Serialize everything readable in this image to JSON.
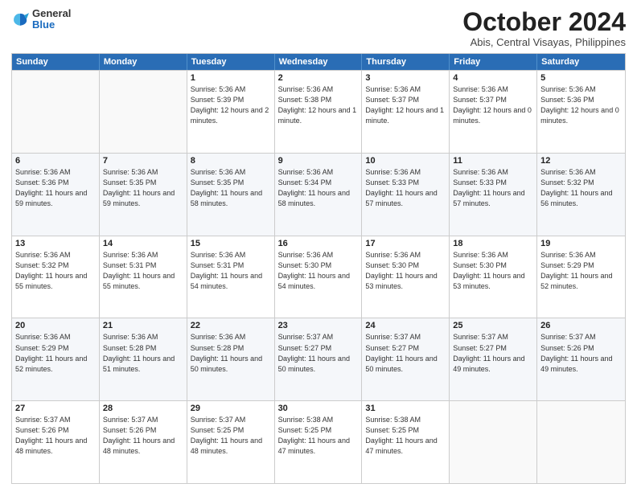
{
  "logo": {
    "general": "General",
    "blue": "Blue"
  },
  "header": {
    "month": "October 2024",
    "location": "Abis, Central Visayas, Philippines"
  },
  "weekdays": [
    "Sunday",
    "Monday",
    "Tuesday",
    "Wednesday",
    "Thursday",
    "Friday",
    "Saturday"
  ],
  "weeks": [
    [
      {
        "day": "",
        "sunrise": "",
        "sunset": "",
        "daylight": ""
      },
      {
        "day": "",
        "sunrise": "",
        "sunset": "",
        "daylight": ""
      },
      {
        "day": "1",
        "sunrise": "Sunrise: 5:36 AM",
        "sunset": "Sunset: 5:39 PM",
        "daylight": "Daylight: 12 hours and 2 minutes."
      },
      {
        "day": "2",
        "sunrise": "Sunrise: 5:36 AM",
        "sunset": "Sunset: 5:38 PM",
        "daylight": "Daylight: 12 hours and 1 minute."
      },
      {
        "day": "3",
        "sunrise": "Sunrise: 5:36 AM",
        "sunset": "Sunset: 5:37 PM",
        "daylight": "Daylight: 12 hours and 1 minute."
      },
      {
        "day": "4",
        "sunrise": "Sunrise: 5:36 AM",
        "sunset": "Sunset: 5:37 PM",
        "daylight": "Daylight: 12 hours and 0 minutes."
      },
      {
        "day": "5",
        "sunrise": "Sunrise: 5:36 AM",
        "sunset": "Sunset: 5:36 PM",
        "daylight": "Daylight: 12 hours and 0 minutes."
      }
    ],
    [
      {
        "day": "6",
        "sunrise": "Sunrise: 5:36 AM",
        "sunset": "Sunset: 5:36 PM",
        "daylight": "Daylight: 11 hours and 59 minutes."
      },
      {
        "day": "7",
        "sunrise": "Sunrise: 5:36 AM",
        "sunset": "Sunset: 5:35 PM",
        "daylight": "Daylight: 11 hours and 59 minutes."
      },
      {
        "day": "8",
        "sunrise": "Sunrise: 5:36 AM",
        "sunset": "Sunset: 5:35 PM",
        "daylight": "Daylight: 11 hours and 58 minutes."
      },
      {
        "day": "9",
        "sunrise": "Sunrise: 5:36 AM",
        "sunset": "Sunset: 5:34 PM",
        "daylight": "Daylight: 11 hours and 58 minutes."
      },
      {
        "day": "10",
        "sunrise": "Sunrise: 5:36 AM",
        "sunset": "Sunset: 5:33 PM",
        "daylight": "Daylight: 11 hours and 57 minutes."
      },
      {
        "day": "11",
        "sunrise": "Sunrise: 5:36 AM",
        "sunset": "Sunset: 5:33 PM",
        "daylight": "Daylight: 11 hours and 57 minutes."
      },
      {
        "day": "12",
        "sunrise": "Sunrise: 5:36 AM",
        "sunset": "Sunset: 5:32 PM",
        "daylight": "Daylight: 11 hours and 56 minutes."
      }
    ],
    [
      {
        "day": "13",
        "sunrise": "Sunrise: 5:36 AM",
        "sunset": "Sunset: 5:32 PM",
        "daylight": "Daylight: 11 hours and 55 minutes."
      },
      {
        "day": "14",
        "sunrise": "Sunrise: 5:36 AM",
        "sunset": "Sunset: 5:31 PM",
        "daylight": "Daylight: 11 hours and 55 minutes."
      },
      {
        "day": "15",
        "sunrise": "Sunrise: 5:36 AM",
        "sunset": "Sunset: 5:31 PM",
        "daylight": "Daylight: 11 hours and 54 minutes."
      },
      {
        "day": "16",
        "sunrise": "Sunrise: 5:36 AM",
        "sunset": "Sunset: 5:30 PM",
        "daylight": "Daylight: 11 hours and 54 minutes."
      },
      {
        "day": "17",
        "sunrise": "Sunrise: 5:36 AM",
        "sunset": "Sunset: 5:30 PM",
        "daylight": "Daylight: 11 hours and 53 minutes."
      },
      {
        "day": "18",
        "sunrise": "Sunrise: 5:36 AM",
        "sunset": "Sunset: 5:30 PM",
        "daylight": "Daylight: 11 hours and 53 minutes."
      },
      {
        "day": "19",
        "sunrise": "Sunrise: 5:36 AM",
        "sunset": "Sunset: 5:29 PM",
        "daylight": "Daylight: 11 hours and 52 minutes."
      }
    ],
    [
      {
        "day": "20",
        "sunrise": "Sunrise: 5:36 AM",
        "sunset": "Sunset: 5:29 PM",
        "daylight": "Daylight: 11 hours and 52 minutes."
      },
      {
        "day": "21",
        "sunrise": "Sunrise: 5:36 AM",
        "sunset": "Sunset: 5:28 PM",
        "daylight": "Daylight: 11 hours and 51 minutes."
      },
      {
        "day": "22",
        "sunrise": "Sunrise: 5:36 AM",
        "sunset": "Sunset: 5:28 PM",
        "daylight": "Daylight: 11 hours and 50 minutes."
      },
      {
        "day": "23",
        "sunrise": "Sunrise: 5:37 AM",
        "sunset": "Sunset: 5:27 PM",
        "daylight": "Daylight: 11 hours and 50 minutes."
      },
      {
        "day": "24",
        "sunrise": "Sunrise: 5:37 AM",
        "sunset": "Sunset: 5:27 PM",
        "daylight": "Daylight: 11 hours and 50 minutes."
      },
      {
        "day": "25",
        "sunrise": "Sunrise: 5:37 AM",
        "sunset": "Sunset: 5:27 PM",
        "daylight": "Daylight: 11 hours and 49 minutes."
      },
      {
        "day": "26",
        "sunrise": "Sunrise: 5:37 AM",
        "sunset": "Sunset: 5:26 PM",
        "daylight": "Daylight: 11 hours and 49 minutes."
      }
    ],
    [
      {
        "day": "27",
        "sunrise": "Sunrise: 5:37 AM",
        "sunset": "Sunset: 5:26 PM",
        "daylight": "Daylight: 11 hours and 48 minutes."
      },
      {
        "day": "28",
        "sunrise": "Sunrise: 5:37 AM",
        "sunset": "Sunset: 5:26 PM",
        "daylight": "Daylight: 11 hours and 48 minutes."
      },
      {
        "day": "29",
        "sunrise": "Sunrise: 5:37 AM",
        "sunset": "Sunset: 5:25 PM",
        "daylight": "Daylight: 11 hours and 48 minutes."
      },
      {
        "day": "30",
        "sunrise": "Sunrise: 5:38 AM",
        "sunset": "Sunset: 5:25 PM",
        "daylight": "Daylight: 11 hours and 47 minutes."
      },
      {
        "day": "31",
        "sunrise": "Sunrise: 5:38 AM",
        "sunset": "Sunset: 5:25 PM",
        "daylight": "Daylight: 11 hours and 47 minutes."
      },
      {
        "day": "",
        "sunrise": "",
        "sunset": "",
        "daylight": ""
      },
      {
        "day": "",
        "sunrise": "",
        "sunset": "",
        "daylight": ""
      }
    ]
  ]
}
